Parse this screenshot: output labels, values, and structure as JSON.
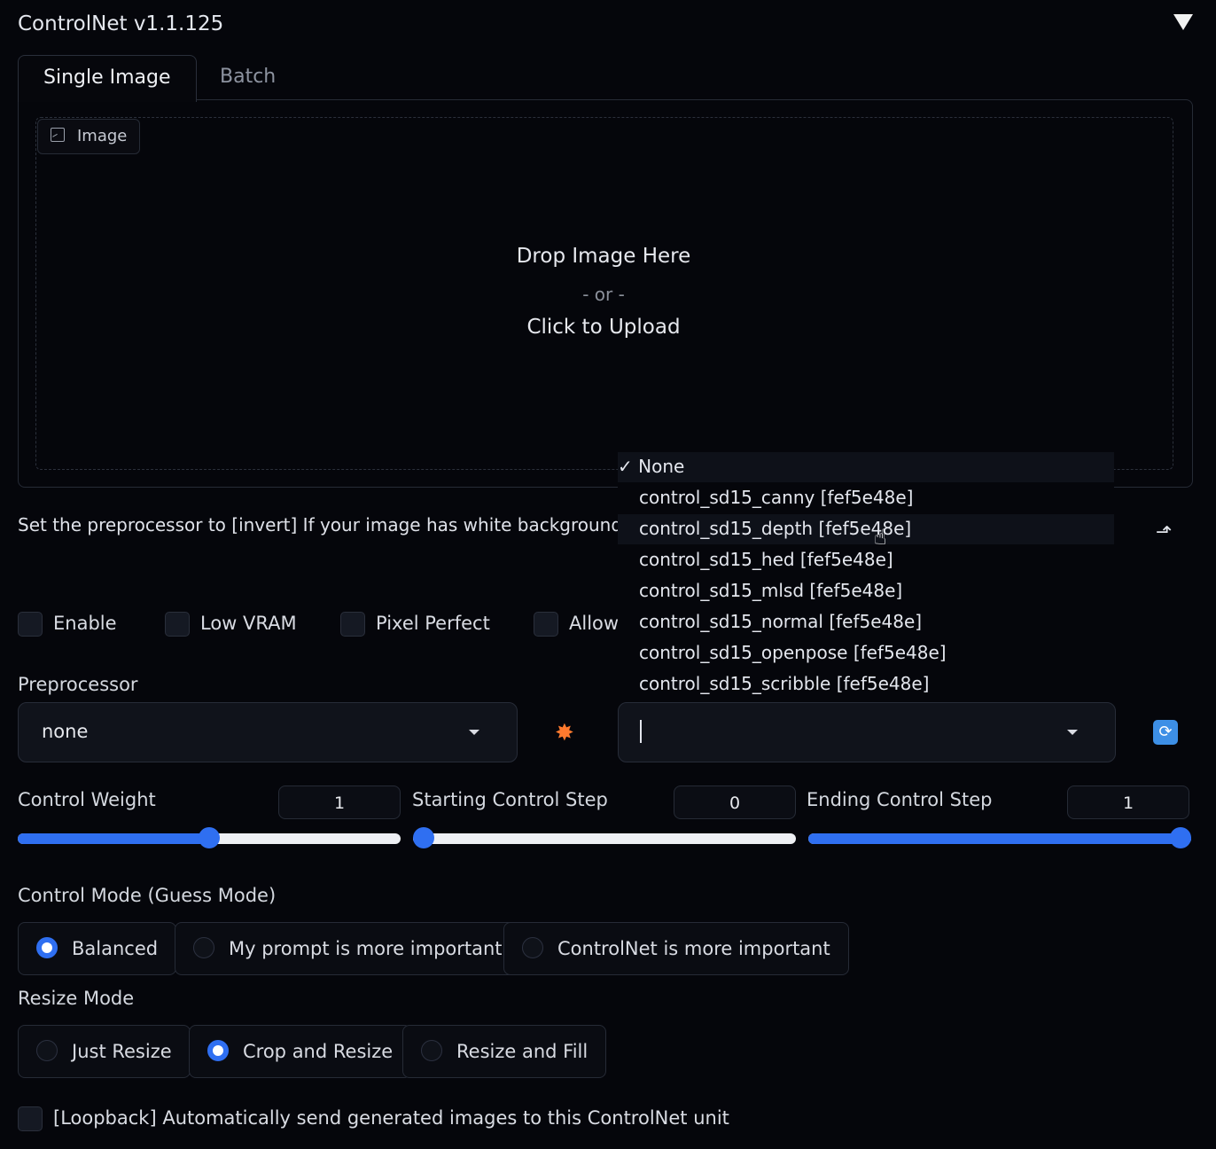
{
  "header": {
    "title": "ControlNet v1.1.125"
  },
  "tabs": [
    {
      "label": "Single Image"
    },
    {
      "label": "Batch"
    }
  ],
  "image_panel": {
    "label": "Image",
    "drop_text": "Drop Image Here",
    "or_text": "- or -",
    "upload_text": "Click to Upload"
  },
  "hint_text": "Set the preprocessor to [invert] If your image has white background and black lines.",
  "checkboxes": [
    {
      "label": "Enable",
      "checked": false
    },
    {
      "label": "Low VRAM",
      "checked": false
    },
    {
      "label": "Pixel Perfect",
      "checked": false
    },
    {
      "label": "Allow",
      "checked": false
    }
  ],
  "preprocessor": {
    "label": "Preprocessor",
    "value": "none"
  },
  "model_dropdown": {
    "value": "",
    "options": [
      "✓ None",
      "control_sd15_canny [fef5e48e]",
      "control_sd15_depth [fef5e48e]",
      "control_sd15_hed [fef5e48e]",
      "control_sd15_mlsd [fef5e48e]",
      "control_sd15_normal [fef5e48e]",
      "control_sd15_openpose [fef5e48e]",
      "control_sd15_scribble [fef5e48e]"
    ],
    "highlighted_index": 2
  },
  "sliders": {
    "weight": {
      "label": "Control Weight",
      "value": "1",
      "fraction": 0.5
    },
    "start": {
      "label": "Starting Control Step",
      "value": "0",
      "fraction": 0.0
    },
    "end": {
      "label": "Ending Control Step",
      "value": "1",
      "fraction": 1.0
    }
  },
  "control_mode": {
    "label": "Control Mode (Guess Mode)",
    "options": [
      "Balanced",
      "My prompt is more important",
      "ControlNet is more important"
    ],
    "selected": 0
  },
  "resize_mode": {
    "label": "Resize Mode",
    "options": [
      "Just Resize",
      "Crop and Resize",
      "Resize and Fill"
    ],
    "selected": 1
  },
  "loopback": {
    "label": "[Loopback] Automatically send generated images to this ControlNet unit",
    "checked": false
  },
  "colors": {
    "accent": "#2f6ff1",
    "background": "#05060b"
  }
}
